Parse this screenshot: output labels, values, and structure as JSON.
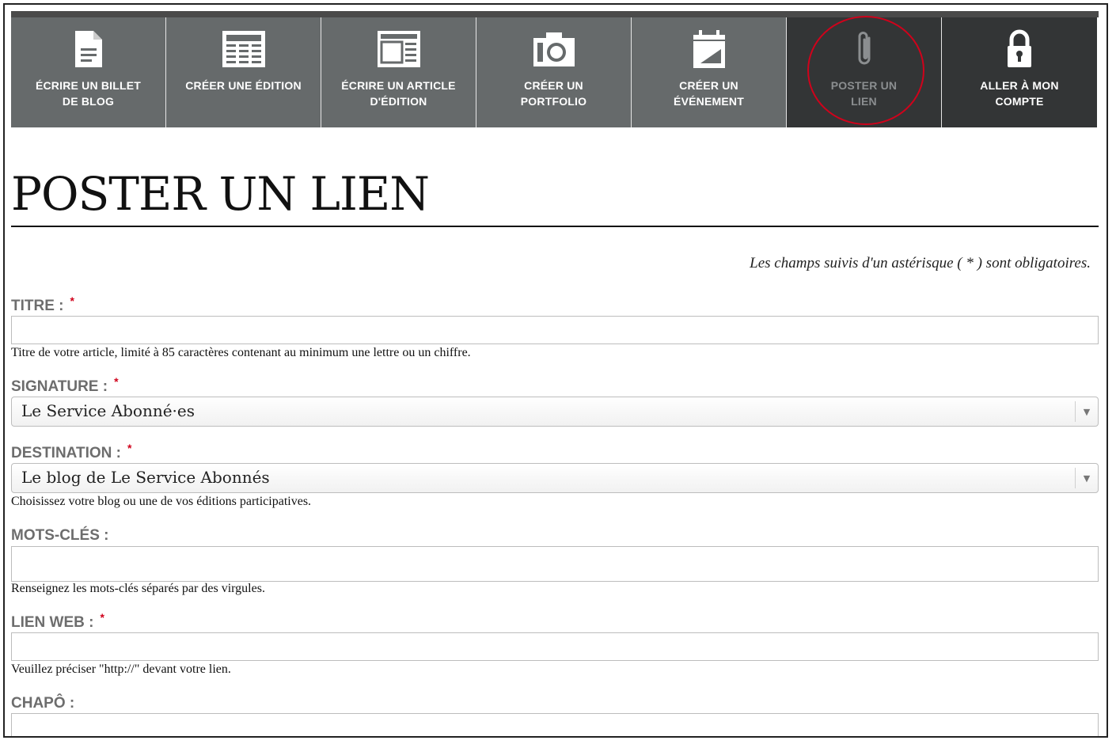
{
  "toolbar": {
    "items": [
      {
        "label": "ÉCRIRE UN BILLET\nDE BLOG",
        "icon": "document-icon"
      },
      {
        "label": "CRÉER UNE ÉDITION",
        "icon": "newspaper-icon"
      },
      {
        "label": "ÉCRIRE UN ARTICLE\nD'ÉDITION",
        "icon": "article-layout-icon"
      },
      {
        "label": "CRÉER UN\nPORTFOLIO",
        "icon": "camera-icon"
      },
      {
        "label": "CRÉER UN\nÉVÉNEMENT",
        "icon": "calendar-icon"
      },
      {
        "label": "POSTER UN\nLIEN",
        "icon": "paperclip-icon",
        "active": true
      },
      {
        "label": "ALLER À MON\nCOMPTE",
        "icon": "lock-icon"
      }
    ],
    "colors": {
      "background": "#666a6b",
      "active_background": "#333536",
      "highlight": "#d0021b"
    }
  },
  "page": {
    "title": "POSTER UN LIEN",
    "required_note": "Les champs suivis d'un astérisque ( * ) sont obligatoires."
  },
  "form": {
    "required_marker": "*",
    "titre": {
      "label": "TITRE :",
      "value": "",
      "help": "Titre de votre article, limité à 85 caractères contenant au minimum une lettre ou un chiffre."
    },
    "signature": {
      "label": "SIGNATURE :",
      "value": "Le Service Abonné·es"
    },
    "destination": {
      "label": "DESTINATION :",
      "value": "Le blog de Le Service Abonnés",
      "help": "Choisissez votre blog ou une de vos éditions participatives."
    },
    "mots_cles": {
      "label": "MOTS-CLÉS :",
      "value": "",
      "help": "Renseignez les mots-clés séparés par des virgules."
    },
    "lien_web": {
      "label": "LIEN WEB :",
      "value": "",
      "help": "Veuillez préciser \"http://\" devant votre lien."
    },
    "chapo": {
      "label": "CHAPÔ :",
      "value": ""
    }
  }
}
